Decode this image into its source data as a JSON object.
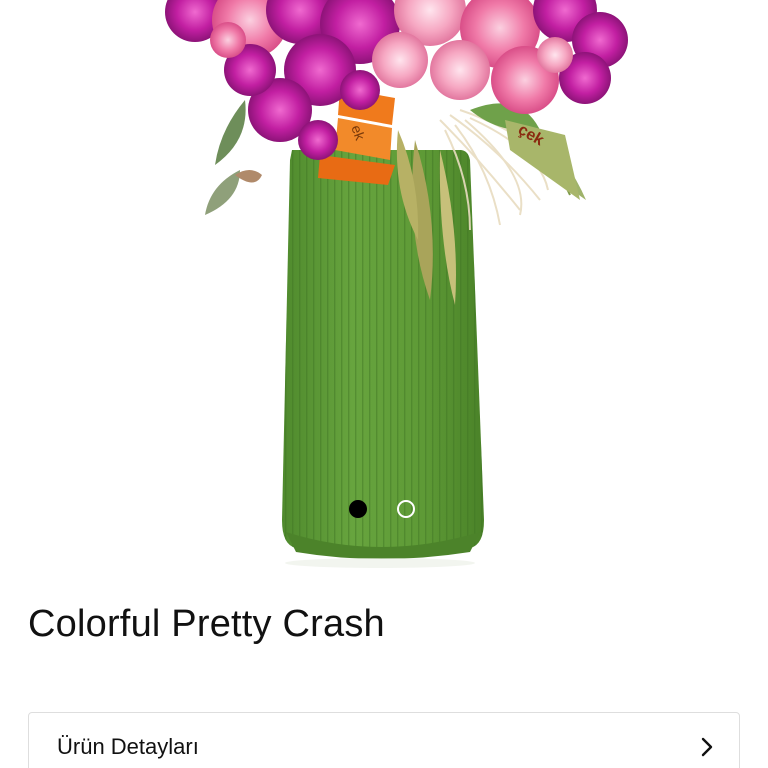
{
  "product": {
    "title": "Colorful Pretty Crash",
    "image_alt": "flower-arrangement-in-green-vase",
    "ribbon_text_1": "ek",
    "ribbon_text_2": "çek"
  },
  "gallery": {
    "total_slides": 2,
    "active_slide": 1
  },
  "details": {
    "label": "Ürün Detayları",
    "icon": "chevron-right-icon"
  },
  "colors": {
    "vase_green": "#5f9a3a",
    "active_dot": "#000000",
    "inactive_dot_border": "#ffffff",
    "border": "#dedede"
  }
}
